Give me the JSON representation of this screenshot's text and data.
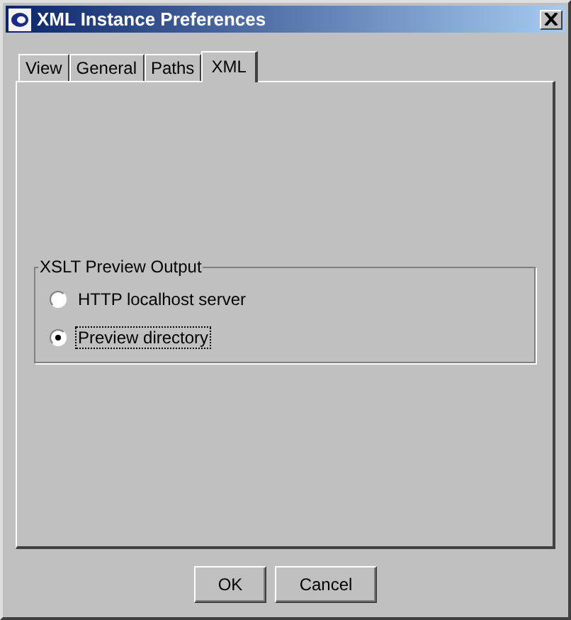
{
  "window": {
    "title": "XML Instance Preferences"
  },
  "tabs": [
    {
      "label": "View",
      "selected": false
    },
    {
      "label": "General",
      "selected": false
    },
    {
      "label": "Paths",
      "selected": false
    },
    {
      "label": "XML",
      "selected": true
    }
  ],
  "group": {
    "title": "XSLT Preview Output",
    "options": [
      {
        "label": "HTTP localhost server",
        "selected": false,
        "focused": false
      },
      {
        "label": "Preview directory",
        "selected": true,
        "focused": true
      }
    ]
  },
  "buttons": [
    "OK",
    "Cancel"
  ]
}
